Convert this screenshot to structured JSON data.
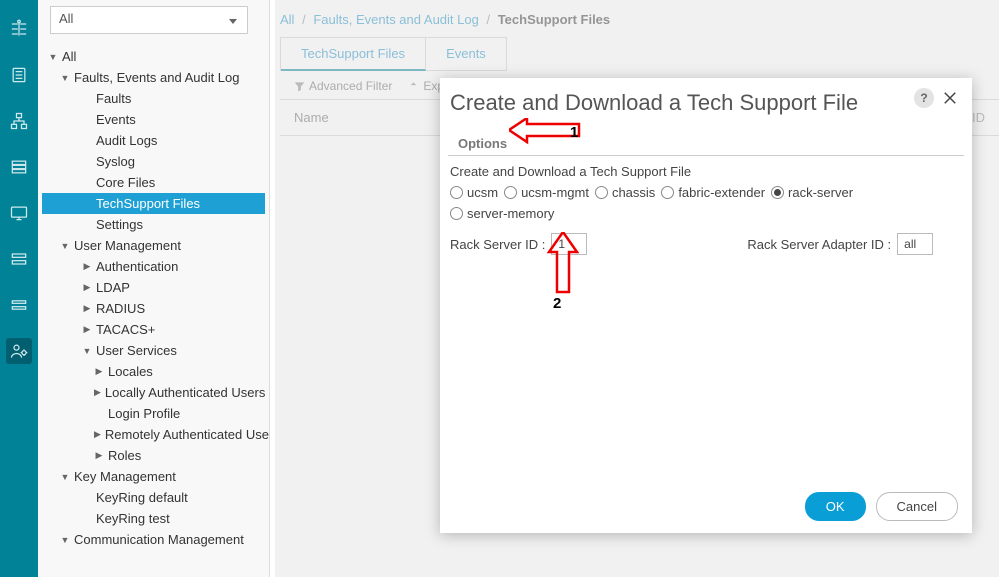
{
  "nav_select": "All",
  "sidebar": {
    "items": [
      {
        "label": "All",
        "indent": 0,
        "caret": "open"
      },
      {
        "label": "Faults, Events and Audit Log",
        "indent": 1,
        "caret": "open"
      },
      {
        "label": "Faults",
        "indent": 2
      },
      {
        "label": "Events",
        "indent": 2
      },
      {
        "label": "Audit Logs",
        "indent": 2
      },
      {
        "label": "Syslog",
        "indent": 2
      },
      {
        "label": "Core Files",
        "indent": 2
      },
      {
        "label": "TechSupport Files",
        "indent": 2,
        "selected": true
      },
      {
        "label": "Settings",
        "indent": 2
      },
      {
        "label": "User Management",
        "indent": 1,
        "caret": "open"
      },
      {
        "label": "Authentication",
        "indent": 3,
        "caret": "closed"
      },
      {
        "label": "LDAP",
        "indent": 3,
        "caret": "closed"
      },
      {
        "label": "RADIUS",
        "indent": 3,
        "caret": "closed"
      },
      {
        "label": "TACACS+",
        "indent": 3,
        "caret": "closed"
      },
      {
        "label": "User Services",
        "indent": 3,
        "caret": "open"
      },
      {
        "label": "Locales",
        "indent": 4,
        "caret": "closed"
      },
      {
        "label": "Locally Authenticated Users",
        "indent": 4,
        "caret": "closed"
      },
      {
        "label": "Login Profile",
        "indent": 4
      },
      {
        "label": "Remotely Authenticated Users",
        "indent": 4,
        "caret": "closed"
      },
      {
        "label": "Roles",
        "indent": 4,
        "caret": "closed"
      },
      {
        "label": "Key Management",
        "indent": 1,
        "caret": "open"
      },
      {
        "label": "KeyRing default",
        "indent": 2
      },
      {
        "label": "KeyRing test",
        "indent": 2
      },
      {
        "label": "Communication Management",
        "indent": 1,
        "caret": "open"
      }
    ]
  },
  "breadcrumb": {
    "a": "All",
    "b": "Faults, Events and Audit Log",
    "c": "TechSupport Files"
  },
  "tabs": {
    "t0": "TechSupport Files",
    "t1": "Events"
  },
  "toolbar": {
    "filter": "Advanced Filter",
    "export": "Export"
  },
  "table": {
    "col_name": "Name",
    "col_r": "ric ID"
  },
  "modal": {
    "title": "Create and Download a Tech Support File",
    "help": "?",
    "section": "Options",
    "desc": "Create and Download a Tech Support File",
    "radios": {
      "r0": "ucsm",
      "r1": "ucsm-mgmt",
      "r2": "chassis",
      "r3": "fabric-extender",
      "r4": "rack-server",
      "r5": "server-memory"
    },
    "field1_label": "Rack Server ID :",
    "field1_value": "1",
    "field2_label": "Rack Server Adapter ID :",
    "field2_value": "all",
    "ok": "OK",
    "cancel": "Cancel"
  },
  "annot": {
    "one": "1",
    "two": "2"
  }
}
